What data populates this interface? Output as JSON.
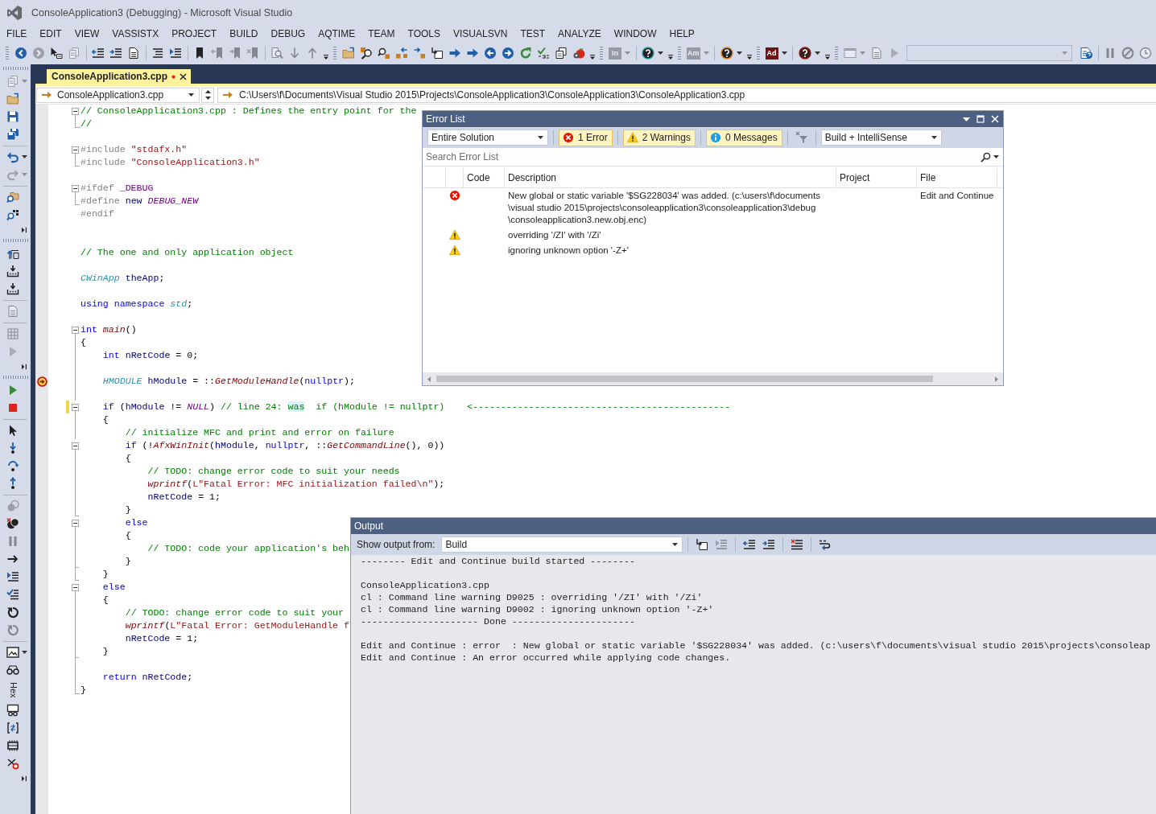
{
  "window": {
    "title": "ConsoleApplication3 (Debugging) - Microsoft Visual Studio"
  },
  "menu": [
    "FILE",
    "EDIT",
    "VIEW",
    "VASSISTX",
    "PROJECT",
    "BUILD",
    "DEBUG",
    "AQTIME",
    "TEAM",
    "TOOLS",
    "VISUALSVN",
    "TEST",
    "ANALYZE",
    "WINDOW",
    "HELP"
  ],
  "toolbar": [
    {
      "kind": "button",
      "disabled": false,
      "menu": false
    },
    {
      "kind": "button",
      "disabled": true,
      "menu": false
    },
    {
      "kind": "button",
      "disabled": false,
      "menu": false
    },
    {
      "kind": "button",
      "disabled": true,
      "menu": false
    },
    {
      "kind": "button",
      "disabled": false,
      "menu": false
    },
    {
      "kind": "button",
      "disabled": false,
      "menu": false
    },
    {
      "kind": "button",
      "disabled": false,
      "menu": false
    },
    {
      "kind": "button",
      "disabled": false,
      "menu": false
    },
    {
      "kind": "button",
      "disabled": false,
      "menu": false
    },
    {
      "kind": "button",
      "disabled": false,
      "menu": false
    },
    {
      "kind": "button",
      "disabled": true,
      "menu": false
    },
    {
      "kind": "button",
      "disabled": true,
      "menu": false
    },
    {
      "kind": "button",
      "disabled": true,
      "menu": false
    },
    {
      "kind": "button",
      "disabled": true,
      "menu": false
    },
    {
      "kind": "button",
      "disabled": true,
      "menu": false
    },
    {
      "kind": "button",
      "disabled": true,
      "menu": false
    },
    {
      "kind": "button",
      "disabled": false,
      "menu": false
    },
    {
      "kind": "button",
      "disabled": false,
      "menu": false
    },
    {
      "kind": "button",
      "disabled": false,
      "menu": false
    },
    {
      "kind": "button",
      "disabled": false,
      "menu": false
    },
    {
      "kind": "button",
      "disabled": false,
      "menu": false
    },
    {
      "kind": "button",
      "disabled": false,
      "menu": false
    },
    {
      "kind": "button",
      "disabled": false,
      "menu": false
    },
    {
      "kind": "button",
      "disabled": false,
      "menu": false
    },
    {
      "kind": "button",
      "disabled": false,
      "menu": false
    },
    {
      "kind": "button",
      "disabled": false,
      "menu": false
    },
    {
      "kind": "button",
      "disabled": false,
      "menu": false
    },
    {
      "kind": "button",
      "disabled": false,
      "menu": false
    },
    {
      "kind": "button",
      "disabled": false,
      "menu": false
    },
    {
      "kind": "button",
      "disabled": false,
      "menu": false
    },
    {
      "kind": "button",
      "disabled": false,
      "menu": false
    },
    {
      "kind": "button",
      "disabled": false,
      "menu": false
    },
    {
      "kind": "text",
      "label": "In",
      "disabled": true,
      "menu": true
    },
    {
      "kind": "button",
      "disabled": false,
      "menu": true
    },
    {
      "kind": "button",
      "disabled": false,
      "menu": false
    },
    {
      "kind": "text",
      "label": "Am",
      "disabled": true,
      "menu": true
    },
    {
      "kind": "button",
      "disabled": false,
      "menu": true
    },
    {
      "kind": "button",
      "disabled": false,
      "menu": false
    },
    {
      "kind": "text",
      "label": "Ad",
      "disabled": false,
      "menu": true
    },
    {
      "kind": "button",
      "disabled": false,
      "menu": true
    },
    {
      "kind": "button",
      "disabled": false,
      "menu": false
    },
    {
      "kind": "button",
      "disabled": true,
      "menu": true
    },
    {
      "kind": "button",
      "disabled": true,
      "menu": false
    },
    {
      "kind": "button",
      "disabled": true,
      "menu": false
    },
    {
      "kind": "combo",
      "disabled": true
    },
    {
      "kind": "button",
      "disabled": false,
      "menu": false
    },
    {
      "kind": "button",
      "disabled": true,
      "menu": false
    },
    {
      "kind": "button",
      "disabled": true,
      "menu": false
    },
    {
      "kind": "button",
      "disabled": true,
      "menu": false
    }
  ],
  "left_toolbar": [
    {
      "kind": "button",
      "disabled": true,
      "menu": true
    },
    {
      "kind": "button",
      "disabled": false,
      "menu": false
    },
    {
      "kind": "button",
      "disabled": false,
      "menu": false
    },
    {
      "kind": "button",
      "disabled": false,
      "menu": false
    },
    {
      "kind": "button",
      "disabled": false,
      "menu": true
    },
    {
      "kind": "button",
      "disabled": true,
      "menu": true
    },
    {
      "kind": "button",
      "disabled": false,
      "menu": false
    },
    {
      "kind": "button",
      "disabled": false,
      "menu": false
    },
    {
      "kind": "button",
      "disabled": false,
      "menu": false
    },
    {
      "kind": "button",
      "disabled": false,
      "menu": false
    },
    {
      "kind": "button",
      "disabled": false,
      "menu": false
    },
    {
      "kind": "button",
      "disabled": false,
      "menu": false
    },
    {
      "kind": "button",
      "disabled": true,
      "menu": false
    },
    {
      "kind": "button",
      "disabled": true,
      "menu": false
    },
    {
      "kind": "button",
      "disabled": true,
      "menu": false
    },
    {
      "kind": "button",
      "disabled": false,
      "menu": false
    },
    {
      "kind": "button",
      "disabled": false,
      "menu": false
    },
    {
      "kind": "button",
      "disabled": false,
      "menu": false
    },
    {
      "kind": "button",
      "disabled": false,
      "menu": false
    },
    {
      "kind": "button",
      "disabled": false,
      "menu": false
    },
    {
      "kind": "button",
      "disabled": false,
      "menu": false
    },
    {
      "kind": "button",
      "disabled": false,
      "menu": false
    },
    {
      "kind": "button",
      "disabled": true,
      "menu": false
    },
    {
      "kind": "button",
      "disabled": false,
      "menu": false
    },
    {
      "kind": "button",
      "disabled": true,
      "menu": false
    },
    {
      "kind": "button",
      "disabled": false,
      "menu": false
    },
    {
      "kind": "button",
      "disabled": false,
      "menu": false
    },
    {
      "kind": "button",
      "disabled": false,
      "menu": false
    },
    {
      "kind": "button",
      "disabled": false,
      "menu": false
    },
    {
      "kind": "button",
      "disabled": true,
      "menu": false
    },
    {
      "kind": "button",
      "disabled": false,
      "menu": true
    },
    {
      "kind": "button",
      "disabled": false,
      "menu": false
    },
    {
      "kind": "text",
      "label": "Hex",
      "disabled": false,
      "menu": false
    },
    {
      "kind": "button",
      "disabled": false,
      "menu": false
    },
    {
      "kind": "button",
      "disabled": false,
      "menu": false
    },
    {
      "kind": "button",
      "disabled": false,
      "menu": false
    },
    {
      "kind": "button",
      "disabled": false,
      "menu": false
    },
    {
      "kind": "button",
      "disabled": false,
      "menu": false
    }
  ],
  "document_tabs": [
    {
      "label": "ConsoleApplication3.cpp",
      "modified": true,
      "selected": true
    }
  ],
  "navigation_bar": {
    "file": "ConsoleApplication3.cpp",
    "path": "C:\\Users\\f\\Documents\\Visual Studio 2015\\Projects\\ConsoleApplication3\\ConsoleApplication3\\ConsoleApplication3.cpp"
  },
  "editor": {
    "lines": [
      {
        "kind": "start",
        "changed": false,
        "breakpoint": false,
        "tokens": [
          {
            "kind": "comment",
            "text": "// ConsoleApplication3.cpp : Defines the entry point for the"
          }
        ]
      },
      {
        "kind": "end",
        "changed": false,
        "breakpoint": false,
        "tokens": [
          {
            "kind": "comment",
            "text": "//"
          }
        ]
      },
      {
        "kind": "plain",
        "changed": false,
        "breakpoint": false
      },
      {
        "kind": "start",
        "changed": false,
        "breakpoint": false,
        "tokens": [
          {
            "kind": "preproc",
            "text": "#include "
          },
          {
            "kind": "string",
            "text": "\"stdafx.h\""
          }
        ]
      },
      {
        "kind": "end",
        "changed": false,
        "breakpoint": false,
        "tokens": [
          {
            "kind": "preproc",
            "text": "#include "
          },
          {
            "kind": "string",
            "text": "\"ConsoleApplication3.h\""
          }
        ]
      },
      {
        "kind": "plain",
        "changed": false,
        "breakpoint": false
      },
      {
        "kind": "start",
        "changed": false,
        "breakpoint": false,
        "tokens": [
          {
            "kind": "preproc",
            "text": "#ifdef "
          },
          {
            "kind": "macro",
            "text": "_DEBUG"
          }
        ]
      },
      {
        "kind": "end",
        "changed": false,
        "breakpoint": false,
        "tokens": [
          {
            "kind": "preproc",
            "text": "#define "
          },
          {
            "kind": "variable",
            "text": "new "
          },
          {
            "kind": "constant",
            "text": "DEBUG_NEW"
          }
        ]
      },
      {
        "kind": "plain",
        "changed": false,
        "breakpoint": false,
        "tokens": [
          {
            "kind": "preproc",
            "text": "#endif"
          }
        ]
      },
      {
        "kind": "plain",
        "changed": false,
        "breakpoint": false
      },
      {
        "kind": "plain",
        "changed": false,
        "breakpoint": false
      },
      {
        "kind": "plain",
        "changed": false,
        "breakpoint": false,
        "tokens": [
          {
            "kind": "comment",
            "text": "// The one and only application object"
          }
        ]
      },
      {
        "kind": "plain",
        "changed": false,
        "breakpoint": false
      },
      {
        "kind": "plain",
        "changed": false,
        "breakpoint": false,
        "tokens": [
          {
            "kind": "type",
            "text": "CWinApp "
          },
          {
            "kind": "variable",
            "text": "theApp"
          },
          {
            "kind": "plain",
            "text": ";"
          }
        ]
      },
      {
        "kind": "plain",
        "changed": false,
        "breakpoint": false
      },
      {
        "kind": "plain",
        "changed": false,
        "breakpoint": false,
        "tokens": [
          {
            "kind": "keyword",
            "text": "using namespace "
          },
          {
            "kind": "type",
            "text": "std"
          },
          {
            "kind": "plain",
            "text": ";"
          }
        ]
      },
      {
        "kind": "plain",
        "changed": false,
        "breakpoint": false
      },
      {
        "kind": "start",
        "changed": false,
        "breakpoint": false,
        "tokens": [
          {
            "kind": "keyword",
            "text": "int "
          },
          {
            "kind": "function",
            "text": "main"
          },
          {
            "kind": "plain",
            "text": "()"
          }
        ]
      },
      {
        "kind": "inside",
        "changed": false,
        "breakpoint": false,
        "tokens": [
          {
            "kind": "plain",
            "text": "{"
          }
        ]
      },
      {
        "kind": "inside",
        "changed": false,
        "breakpoint": false,
        "tokens": [
          {
            "kind": "keyword",
            "text": "    int "
          },
          {
            "kind": "variable",
            "text": "nRetCode"
          },
          {
            "kind": "plain",
            "text": " = 0;"
          }
        ]
      },
      {
        "kind": "inside",
        "changed": false,
        "breakpoint": false
      },
      {
        "kind": "inside",
        "changed": false,
        "breakpoint": true,
        "tokens": [
          {
            "kind": "type",
            "text": "    HMODULE "
          },
          {
            "kind": "variable",
            "text": "hModule"
          },
          {
            "kind": "plain",
            "text": " = ::"
          },
          {
            "kind": "function",
            "text": "GetModuleHandle"
          },
          {
            "kind": "plain",
            "text": "("
          },
          {
            "kind": "keyword",
            "text": "nullptr"
          },
          {
            "kind": "plain",
            "text": ");"
          }
        ]
      },
      {
        "kind": "inside",
        "changed": false,
        "breakpoint": false
      },
      {
        "kind": "start",
        "changed": true,
        "breakpoint": false,
        "tokens": [
          {
            "kind": "keyword",
            "text": "    if"
          },
          {
            "kind": "plain",
            "text": " ("
          },
          {
            "kind": "variable",
            "text": "hModule"
          },
          {
            "kind": "plain",
            "text": " != "
          },
          {
            "kind": "constant",
            "text": "NULL"
          },
          {
            "kind": "plain",
            "text": ") "
          },
          {
            "kind": "comment",
            "text": "// line 24: "
          },
          {
            "kind": "match",
            "text": "was"
          },
          {
            "kind": "comment",
            "text": "  if (hModule != nullptr)    <----------------------------------------------"
          }
        ]
      },
      {
        "kind": "inside",
        "changed": false,
        "breakpoint": false,
        "tokens": [
          {
            "kind": "plain",
            "text": "    {"
          }
        ]
      },
      {
        "kind": "inside",
        "changed": false,
        "breakpoint": false,
        "tokens": [
          {
            "kind": "comment",
            "text": "        // initialize MFC and print and error on failure"
          }
        ]
      },
      {
        "kind": "start",
        "changed": false,
        "breakpoint": false,
        "tokens": [
          {
            "kind": "keyword",
            "text": "        if"
          },
          {
            "kind": "plain",
            "text": " (!"
          },
          {
            "kind": "function",
            "text": "AfxWinInit"
          },
          {
            "kind": "plain",
            "text": "("
          },
          {
            "kind": "variable",
            "text": "hModule"
          },
          {
            "kind": "plain",
            "text": ", "
          },
          {
            "kind": "keyword",
            "text": "nullptr"
          },
          {
            "kind": "plain",
            "text": ", ::"
          },
          {
            "kind": "function",
            "text": "GetCommandLine"
          },
          {
            "kind": "plain",
            "text": "(), 0))"
          }
        ]
      },
      {
        "kind": "inside",
        "changed": false,
        "breakpoint": false,
        "tokens": [
          {
            "kind": "plain",
            "text": "        {"
          }
        ]
      },
      {
        "kind": "inside",
        "changed": false,
        "breakpoint": false,
        "tokens": [
          {
            "kind": "comment",
            "text": "            // TODO: change error code to suit your needs"
          }
        ]
      },
      {
        "kind": "inside",
        "changed": false,
        "breakpoint": false,
        "tokens": [
          {
            "kind": "function",
            "text": "            wprintf"
          },
          {
            "kind": "plain",
            "text": "("
          },
          {
            "kind": "string",
            "text": "L\"Fatal Error: MFC initialization failed\\n\""
          },
          {
            "kind": "plain",
            "text": ");"
          }
        ]
      },
      {
        "kind": "inside",
        "changed": false,
        "breakpoint": false,
        "tokens": [
          {
            "kind": "variable",
            "text": "            nRetCode"
          },
          {
            "kind": "plain",
            "text": " = 1;"
          }
        ]
      },
      {
        "kind": "tick",
        "changed": false,
        "breakpoint": false,
        "tokens": [
          {
            "kind": "plain",
            "text": "        }"
          }
        ]
      },
      {
        "kind": "start",
        "changed": false,
        "breakpoint": false,
        "tokens": [
          {
            "kind": "keyword",
            "text": "        else"
          }
        ]
      },
      {
        "kind": "inside",
        "changed": false,
        "breakpoint": false,
        "tokens": [
          {
            "kind": "plain",
            "text": "        {"
          }
        ]
      },
      {
        "kind": "inside",
        "changed": false,
        "breakpoint": false,
        "tokens": [
          {
            "kind": "comment",
            "text": "            // TODO: code your application's beh"
          }
        ]
      },
      {
        "kind": "tick",
        "changed": false,
        "breakpoint": false,
        "tokens": [
          {
            "kind": "plain",
            "text": "        }"
          }
        ]
      },
      {
        "kind": "tick",
        "changed": false,
        "breakpoint": false,
        "tokens": [
          {
            "kind": "plain",
            "text": "    }"
          }
        ]
      },
      {
        "kind": "start",
        "changed": false,
        "breakpoint": false,
        "tokens": [
          {
            "kind": "keyword",
            "text": "    else"
          }
        ]
      },
      {
        "kind": "inside",
        "changed": false,
        "breakpoint": false,
        "tokens": [
          {
            "kind": "plain",
            "text": "    {"
          }
        ]
      },
      {
        "kind": "inside",
        "changed": false,
        "breakpoint": false,
        "tokens": [
          {
            "kind": "comment",
            "text": "        // TODO: change error code to suit your"
          }
        ]
      },
      {
        "kind": "inside",
        "changed": false,
        "breakpoint": false,
        "tokens": [
          {
            "kind": "function",
            "text": "        wprintf"
          },
          {
            "kind": "plain",
            "text": "("
          },
          {
            "kind": "string",
            "text": "L\"Fatal Error: GetModuleHandle f"
          }
        ]
      },
      {
        "kind": "inside",
        "changed": false,
        "breakpoint": false,
        "tokens": [
          {
            "kind": "variable",
            "text": "        nRetCode"
          },
          {
            "kind": "plain",
            "text": " = 1;"
          }
        ]
      },
      {
        "kind": "tick",
        "changed": false,
        "breakpoint": false,
        "tokens": [
          {
            "kind": "plain",
            "text": "    }"
          }
        ]
      },
      {
        "kind": "inside",
        "changed": false,
        "breakpoint": false
      },
      {
        "kind": "inside",
        "changed": false,
        "breakpoint": false,
        "tokens": [
          {
            "kind": "keyword",
            "text": "    return "
          },
          {
            "kind": "variable",
            "text": "nRetCode"
          },
          {
            "kind": "plain",
            "text": ";"
          }
        ]
      },
      {
        "kind": "end",
        "changed": false,
        "breakpoint": false,
        "tokens": [
          {
            "kind": "plain",
            "text": "}"
          }
        ]
      }
    ]
  },
  "error_list": {
    "title": "Error List",
    "scope": "Entire Solution",
    "filters": [
      {
        "kind": "error",
        "label": "1 Error",
        "selected": true
      },
      {
        "kind": "warning",
        "label": "2 Warnings",
        "selected": true
      },
      {
        "kind": "message",
        "label": "0 Messages",
        "selected": true
      }
    ],
    "clear_filter": {
      "disabled": true
    },
    "source": "Build + IntelliSense",
    "search": {
      "placeholder": "Search Error List"
    },
    "columns": [
      "Code",
      "Description",
      "Project",
      "File"
    ],
    "rows": [
      {
        "kind": "error",
        "description": "New global or static variable '$SG228034' was added. (c:\\users\\f\\documents\\visual studio 2015\\projects\\consoleapplication3\\consoleapplication3\\debug\\consoleapplication3.new.obj.enc)",
        "file": "Edit and Continue"
      },
      {
        "kind": "warning",
        "description": "overriding '/ZI' with '/Zi'"
      },
      {
        "kind": "warning",
        "description": "ignoring unknown option '-Z+'"
      }
    ]
  },
  "output": {
    "title": "Output",
    "source_label": "Show output from:",
    "source": "Build",
    "buttons": [
      {
        "disabled": false
      },
      {
        "disabled": true
      },
      {
        "disabled": false
      },
      {
        "disabled": false
      },
      {
        "disabled": false
      },
      {
        "disabled": false
      }
    ],
    "blocks": [
      [
        "-------- Edit and Continue build started --------"
      ],
      [
        "ConsoleApplication3.cpp",
        "cl : Command line warning D9025 : overriding '/ZI' with '/Zi'",
        "cl : Command line warning D9002 : ignoring unknown option '-Z+'",
        "--------------------- Done ----------------------"
      ],
      [
        "Edit and Continue : error  : New global or static variable '$SG228034' was added. (c:\\users\\f\\documents\\visual studio 2015\\projects\\consoleap",
        "Edit and Continue : An error occurred while applying code changes."
      ]
    ]
  }
}
